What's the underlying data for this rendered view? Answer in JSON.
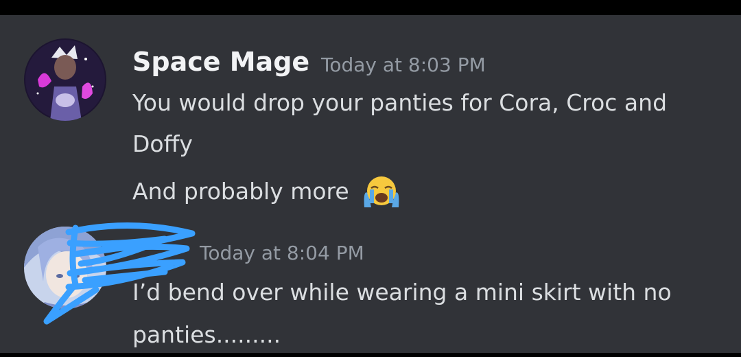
{
  "messages": [
    {
      "username": "Space Mage",
      "timestamp": "Today at 8:03 PM",
      "lines": [
        "You would drop your panties for Cora, Croc and",
        "Doffy",
        "And probably more"
      ],
      "emoji": "loudly-crying-face"
    },
    {
      "username": "",
      "timestamp": "Today at 8:04 PM",
      "lines": [
        "I’d bend over while wearing a mini skirt with no",
        "panties........."
      ]
    }
  ],
  "colors": {
    "background": "#313338",
    "username": "#f2f3f5",
    "timestamp": "#949ba4",
    "message_text": "#dbdee1",
    "scribble": "#3aa0ff"
  }
}
